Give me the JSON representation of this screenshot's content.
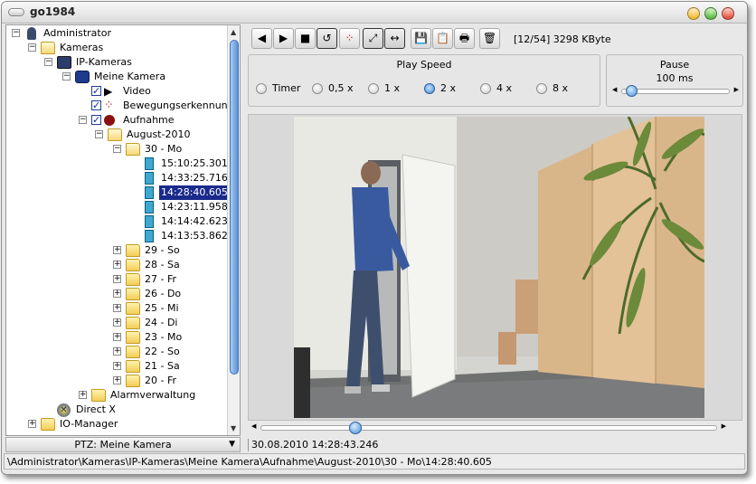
{
  "window": {
    "title": "go1984"
  },
  "tree": {
    "rows": [
      {
        "label": "Administrator",
        "icon": "admin-icon",
        "level": 0,
        "expander": "-"
      },
      {
        "label": "Kameras",
        "icon": "folder-open-icon",
        "level": 1,
        "expander": "-"
      },
      {
        "label": "IP-Kameras",
        "icon": "network-camera-icon",
        "level": 2,
        "expander": "-"
      },
      {
        "label": "Meine Kamera",
        "icon": "camera-icon",
        "level": 3,
        "expander": "-"
      },
      {
        "label": "Video",
        "icon": "play-icon",
        "level": 4,
        "checked": true
      },
      {
        "label": "Bewegungserkennung",
        "icon": "motion-detection-icon",
        "level": 4,
        "checked": true
      },
      {
        "label": "Aufnahme",
        "icon": "record-icon",
        "level": 4,
        "checked": true,
        "expander": "-"
      },
      {
        "label": "August-2010",
        "icon": "folder-open-icon",
        "level": 5,
        "expander": "-"
      },
      {
        "label": "30 - Mo",
        "icon": "folder-open-icon",
        "level": 6,
        "expander": "-"
      },
      {
        "label": "15:10:25.301",
        "icon": "recording-file-icon",
        "level": 7
      },
      {
        "label": "14:33:25.716",
        "icon": "recording-file-icon",
        "level": 7
      },
      {
        "label": "14:28:40.605",
        "icon": "recording-file-icon",
        "level": 7,
        "selected": true
      },
      {
        "label": "14:23:11.958",
        "icon": "recording-file-icon",
        "level": 7
      },
      {
        "label": "14:14:42.623",
        "icon": "recording-file-icon",
        "level": 7
      },
      {
        "label": "14:13:53.862",
        "icon": "recording-file-icon",
        "level": 7
      },
      {
        "label": "29 - So",
        "icon": "folder-icon",
        "level": 6,
        "expander": "+"
      },
      {
        "label": "28 - Sa",
        "icon": "folder-icon",
        "level": 6,
        "expander": "+"
      },
      {
        "label": "27 - Fr",
        "icon": "folder-icon",
        "level": 6,
        "expander": "+"
      },
      {
        "label": "26 - Do",
        "icon": "folder-icon",
        "level": 6,
        "expander": "+"
      },
      {
        "label": "25 - Mi",
        "icon": "folder-icon",
        "level": 6,
        "expander": "+"
      },
      {
        "label": "24 - Di",
        "icon": "folder-icon",
        "level": 6,
        "expander": "+"
      },
      {
        "label": "23 - Mo",
        "icon": "folder-icon",
        "level": 6,
        "expander": "+"
      },
      {
        "label": "22 - So",
        "icon": "folder-icon",
        "level": 6,
        "expander": "+"
      },
      {
        "label": "21 - Sa",
        "icon": "folder-icon",
        "level": 6,
        "expander": "+"
      },
      {
        "label": "20 - Fr",
        "icon": "folder-icon",
        "level": 6,
        "expander": "+"
      },
      {
        "label": "Alarmverwaltung",
        "icon": "folder-icon",
        "level": 4,
        "expander": "+"
      },
      {
        "label": "Direct X",
        "icon": "directx-icon",
        "level": 2
      },
      {
        "label": "IO-Manager",
        "icon": "folder-icon",
        "level": 1,
        "expander": "+"
      }
    ]
  },
  "ptz": {
    "label": "PTZ: Meine Kamera"
  },
  "toolbar": {
    "buttons": [
      {
        "name": "previous-button",
        "icon": "previous-icon",
        "glyph": "◀"
      },
      {
        "name": "play-button",
        "icon": "play-icon",
        "glyph": "▶"
      },
      {
        "name": "stop-button",
        "icon": "stop-icon",
        "glyph": "■"
      },
      {
        "name": "loop-button",
        "icon": "loop-icon",
        "glyph": "↺",
        "active": true
      },
      {
        "name": "motion-markers-button",
        "icon": "motion-markers-icon",
        "glyph": "⁘"
      },
      {
        "name": "fullscreen-button",
        "icon": "fullscreen-icon",
        "glyph": "⤢",
        "active": true
      },
      {
        "name": "fit-width-button",
        "icon": "fit-width-icon",
        "glyph": "↔",
        "active": true
      },
      {
        "name": "save-button",
        "icon": "save-icon",
        "glyph": "💾"
      },
      {
        "name": "clipboard-button",
        "icon": "clipboard-icon",
        "glyph": "📋"
      },
      {
        "name": "print-button",
        "icon": "print-icon",
        "glyph": "🖶"
      },
      {
        "name": "delete-button",
        "icon": "recycle-bin-icon",
        "glyph": "🗑"
      }
    ],
    "status": "[12/54] 3298 KByte"
  },
  "play_speed": {
    "title": "Play Speed",
    "options": [
      {
        "label": "Timer",
        "selected": false
      },
      {
        "label": "0,5 x",
        "selected": false
      },
      {
        "label": "1 x",
        "selected": false
      },
      {
        "label": "2 x",
        "selected": true
      },
      {
        "label": "4 x",
        "selected": false
      },
      {
        "label": "8 x",
        "selected": false
      }
    ]
  },
  "pause": {
    "title": "Pause",
    "value": "100 ms",
    "level": 0.05
  },
  "playback": {
    "position": 0.2
  },
  "timestamp": "30.08.2010 14:28:43.246",
  "status_path": "\\Administrator\\Kameras\\IP-Kameras\\Meine Kamera\\Aufnahme\\August-2010\\30 - Mo\\14:28:40.605"
}
